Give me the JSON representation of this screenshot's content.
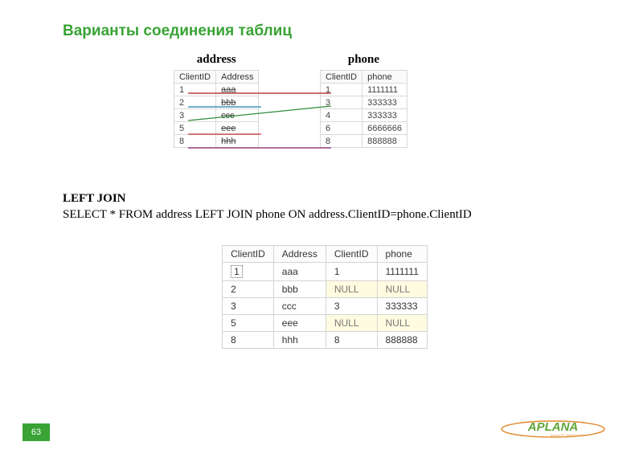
{
  "title": "Варианты соединения таблиц",
  "labels": {
    "address": "address",
    "phone": "phone"
  },
  "address_table": {
    "headers": [
      "ClientID",
      "Address"
    ],
    "rows": [
      {
        "id": "1",
        "val": "aaa"
      },
      {
        "id": "2",
        "val": "bbb"
      },
      {
        "id": "3",
        "val": "ccc"
      },
      {
        "id": "5",
        "val": "eee"
      },
      {
        "id": "8",
        "val": "hhh"
      }
    ]
  },
  "phone_table": {
    "headers": [
      "ClientID",
      "phone"
    ],
    "rows": [
      {
        "id": "1",
        "val": "1111111"
      },
      {
        "id": "3",
        "val": "333333"
      },
      {
        "id": "4",
        "val": "333333"
      },
      {
        "id": "6",
        "val": "6666666"
      },
      {
        "id": "8",
        "val": "888888"
      }
    ]
  },
  "join": {
    "head": "LEFT JOIN",
    "sql": "SELECT * FROM address LEFT JOIN phone ON address.ClientID=phone.ClientID"
  },
  "result_table": {
    "headers": [
      "ClientID",
      "Address",
      "ClientID",
      "phone"
    ],
    "rows": [
      {
        "c1": "1",
        "c2": "aaa",
        "c3": "1",
        "c4": "1111111",
        "null": false,
        "sel": true
      },
      {
        "c1": "2",
        "c2": "bbb",
        "c3": "NULL",
        "c4": "NULL",
        "null": true,
        "sel": false
      },
      {
        "c1": "3",
        "c2": "ccc",
        "c3": "3",
        "c4": "333333",
        "null": false,
        "sel": false
      },
      {
        "c1": "5",
        "c2": "eee",
        "c3": "NULL",
        "c4": "NULL",
        "null": true,
        "sel": false
      },
      {
        "c1": "8",
        "c2": "hhh",
        "c3": "8",
        "c4": "888888",
        "null": false,
        "sel": false
      }
    ]
  },
  "page_number": "63",
  "logo": {
    "text": "APLANA",
    "subtitle": "QUALITY SERVICES"
  },
  "colors": {
    "accent": "#39a335",
    "logo_green": "#5fa637",
    "logo_orange": "#e18a2f"
  }
}
